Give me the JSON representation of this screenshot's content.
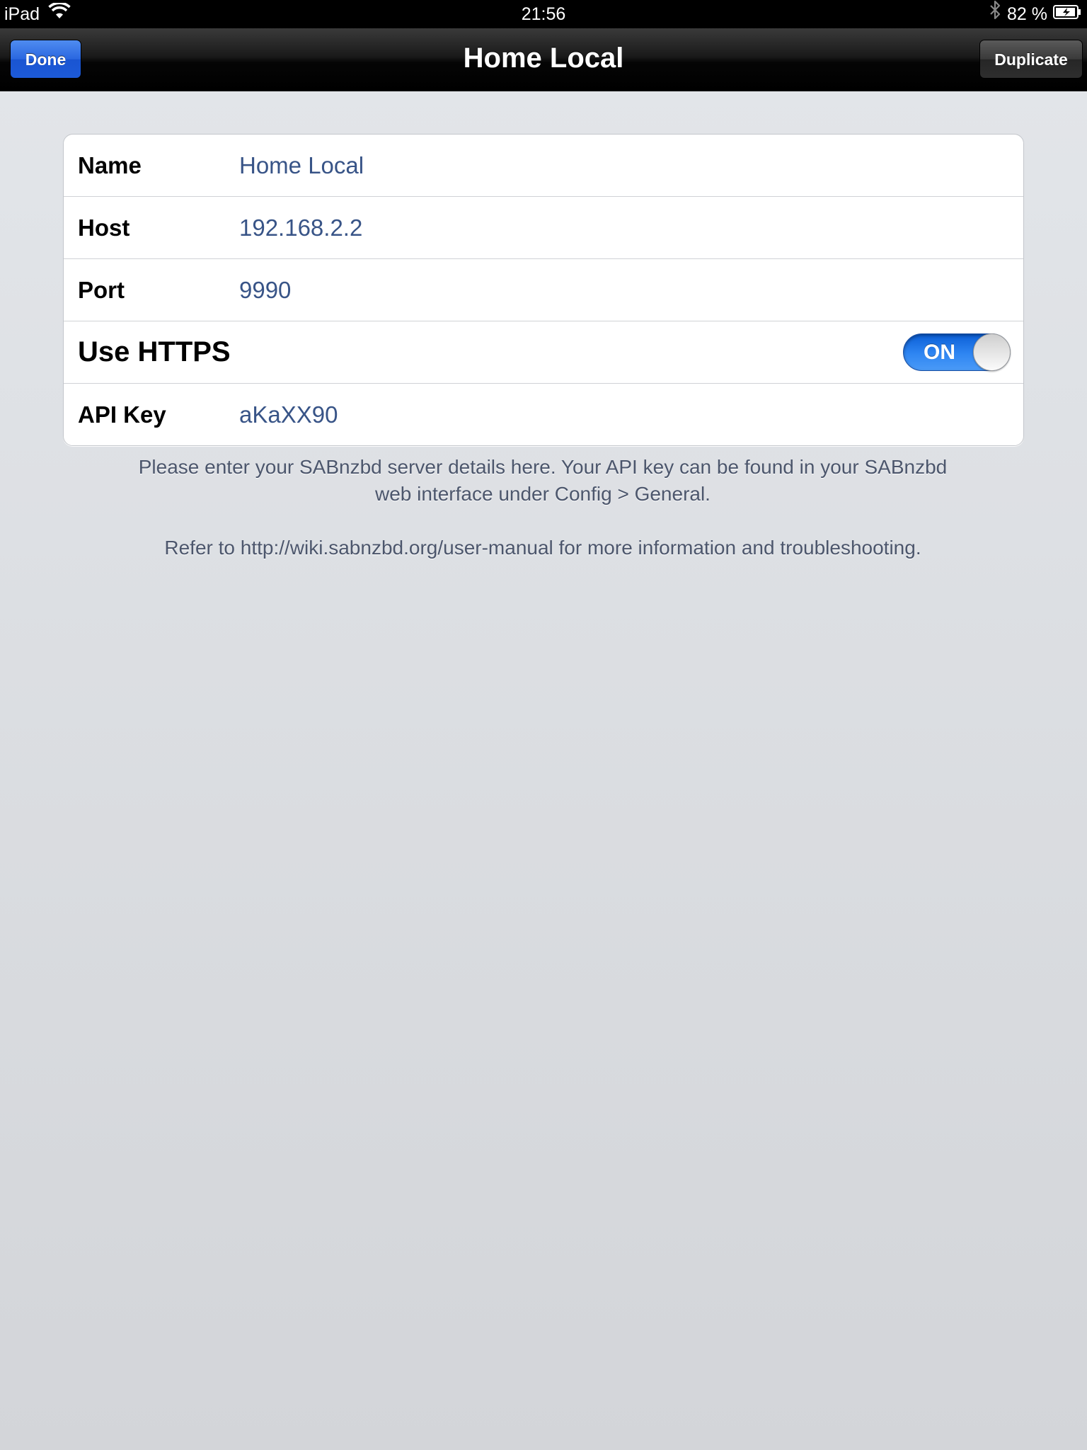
{
  "status_bar": {
    "carrier": "iPad",
    "time": "21:56",
    "battery_percent": "82 %"
  },
  "nav_bar": {
    "title": "Home Local",
    "left_button": "Done",
    "right_button": "Duplicate"
  },
  "form": {
    "rows": [
      {
        "label": "Name",
        "value": "Home Local"
      },
      {
        "label": "Host",
        "value": "192.168.2.2"
      },
      {
        "label": "Port",
        "value": "9990"
      },
      {
        "label": "Use HTTPS",
        "toggle": "ON"
      },
      {
        "label": "API Key",
        "value": "aKaXX90"
      }
    ]
  },
  "footer": {
    "line1": "Please enter your SABnzbd server details here. Your API key can be found in your SABnzbd",
    "line2": "web interface under Config > General.",
    "line3": "Refer to http://wiki.sabnzbd.org/user-manual for more information and troubleshooting."
  },
  "colors": {
    "accent": "#2a67e0",
    "value_text": "#385487",
    "toggle_on": "#2f86f2"
  }
}
